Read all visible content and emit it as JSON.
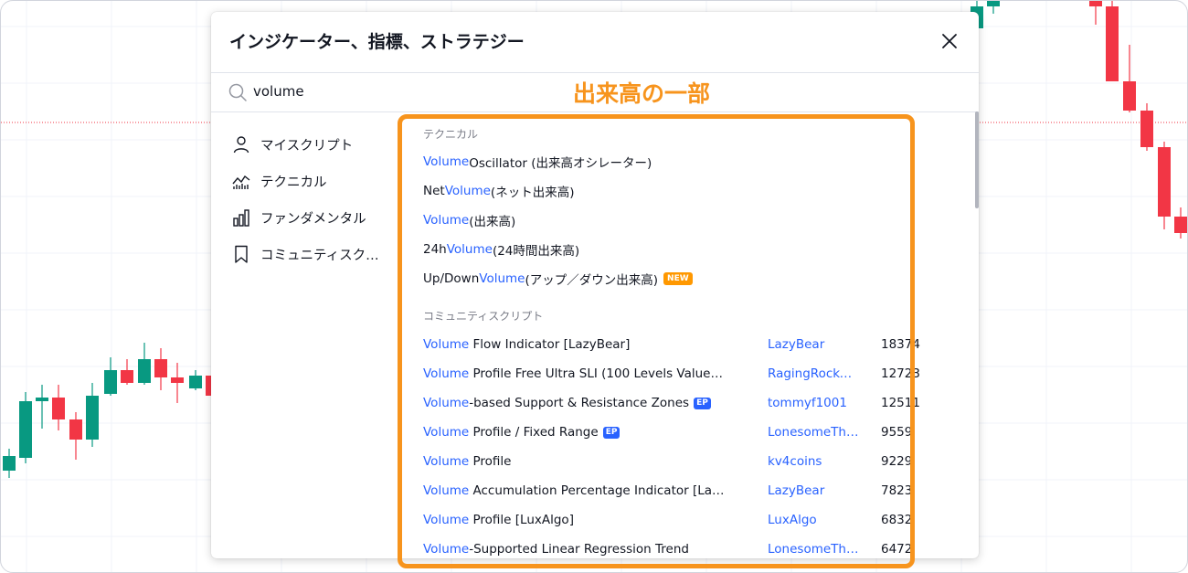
{
  "dialog": {
    "title": "インジケーター、指標、ストラテジー",
    "search": {
      "value": "volume",
      "placeholder": ""
    }
  },
  "annotation": {
    "label": "出来高の一部",
    "color": "#f7941d"
  },
  "sidebar": {
    "items": [
      {
        "label": "マイスクリプト",
        "icon": "person-icon"
      },
      {
        "label": "テクニカル",
        "icon": "technical-chart-icon"
      },
      {
        "label": "ファンダメンタル",
        "icon": "bar-chart-icon"
      },
      {
        "label": "コミュニティスクリ...",
        "icon": "bookmark-icon"
      }
    ]
  },
  "results": {
    "technical": {
      "heading": "テクニカル",
      "items": [
        {
          "pre": "",
          "hl": "Volume",
          "post": " Oscillator (出来高オシレーター)",
          "badge": ""
        },
        {
          "pre": "Net ",
          "hl": "Volume",
          "post": " (ネット出来高)",
          "badge": ""
        },
        {
          "pre": "",
          "hl": "Volume",
          "post": " (出来高)",
          "badge": ""
        },
        {
          "pre": "24h ",
          "hl": "Volume",
          "post": " (24時間出来高)",
          "badge": ""
        },
        {
          "pre": "Up/Down ",
          "hl": "Volume",
          "post": " (アップ／ダウン出来高)",
          "badge": "NEW"
        }
      ]
    },
    "community": {
      "heading": "コミュニティスクリプト",
      "items": [
        {
          "hl": "Volume",
          "post": " Flow Indicator [LazyBear]",
          "badge": "",
          "author": "LazyBear",
          "count": "18374"
        },
        {
          "hl": "Volume",
          "post": " Profile Free Ultra SLI (100 Levels Value A...",
          "badge": "",
          "author": "RagingRocket...",
          "count": "12723"
        },
        {
          "hl": "Volume",
          "post": "-based Support & Resistance Zones",
          "badge": "EP",
          "author": "tommyf1001",
          "count": "12511"
        },
        {
          "hl": "Volume",
          "post": " Profile / Fixed Range",
          "badge": "EP",
          "author": "LonesomeThe...",
          "count": "9559"
        },
        {
          "hl": "Volume",
          "post": " Profile",
          "badge": "",
          "author": "kv4coins",
          "count": "9229"
        },
        {
          "hl": "Volume",
          "post": " Accumulation Percentage Indicator [Lazy...",
          "badge": "",
          "author": "LazyBear",
          "count": "7823"
        },
        {
          "hl": "Volume",
          "post": " Profile [LuxAlgo]",
          "badge": "",
          "author": "LuxAlgo",
          "count": "6832"
        },
        {
          "hl": "Volume",
          "post": "-Supported Linear Regression Trend",
          "badge": "",
          "author": "LonesomeThe...",
          "count": "6472"
        }
      ]
    }
  },
  "colors": {
    "up_candle": "#089981",
    "down_candle": "#f23645",
    "highlight": "#2962ff",
    "new_badge": "#ff9800",
    "ep_badge": "#2962ff"
  }
}
